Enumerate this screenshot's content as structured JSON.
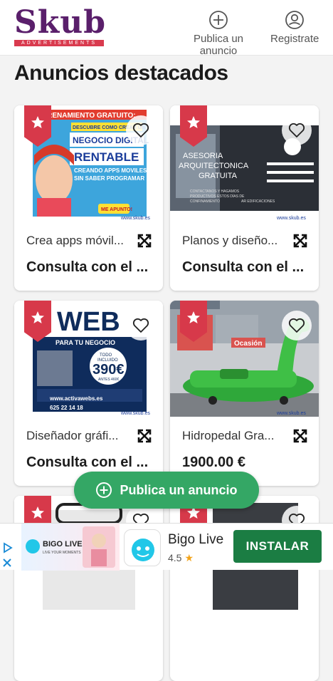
{
  "header": {
    "logo_text": "Skub",
    "logo_subtitle": "ADVERTISEMENTS",
    "post_ad_label": "Publica un anuncio",
    "register_label": "Registrate"
  },
  "section_title": "Anuncios destacados",
  "cards": [
    {
      "title": "Crea apps móvil...",
      "price": "Consulta con el ..."
    },
    {
      "title": "Planos y diseño...",
      "price": "Consulta con el ..."
    },
    {
      "title": "Diseñador gráfi...",
      "price": "Consulta con el ..."
    },
    {
      "title": "Hidropedal Gra...",
      "price": "1900.00 €"
    }
  ],
  "card_images": [
    {
      "lines": [
        "TRENAMIENTO GRATUITO:",
        "DESCUBRE COMO CREAR UN",
        "NEGOCIO DIGITAL",
        "RENTABLE",
        "CREANDO APPS MOVILES",
        "SIN SABER PROGRAMAR",
        "ME APUNTO!",
        "www.skub.es"
      ]
    },
    {
      "lines": [
        "ASESORIA",
        "ARQUITECTONICA",
        "GRATUITA",
        "CONTACTANOS Y HAGAMOS",
        "PRODUCTIVOS ESTOS DÍAS DE",
        "CONFINAMIENTO",
        "AR EDIFICACIONES",
        "www.skub.es"
      ]
    },
    {
      "lines": [
        "WEB",
        "PARA TU NEGOCIO",
        "TODO",
        "INCLUIDO",
        "390€",
        "ANTES 460€",
        "www.activawebs.es",
        "625 22 14 18",
        "www.skub.es"
      ]
    },
    {
      "lines": [
        "Ocasión",
        "www.skub.es"
      ]
    }
  ],
  "fab_label": "Publica un anuncio",
  "ad": {
    "banner_text": "BIGO LIVE",
    "banner_tagline": "LIVE YOUR MOMENTS",
    "app_name": "Bigo Live",
    "rating": "4.5",
    "install_label": "INSTALAR"
  },
  "colors": {
    "brand_purple": "#5a1f6b",
    "ribbon_red": "#d7394a",
    "fab_green": "#34a765",
    "install_green": "#1b7d43"
  }
}
